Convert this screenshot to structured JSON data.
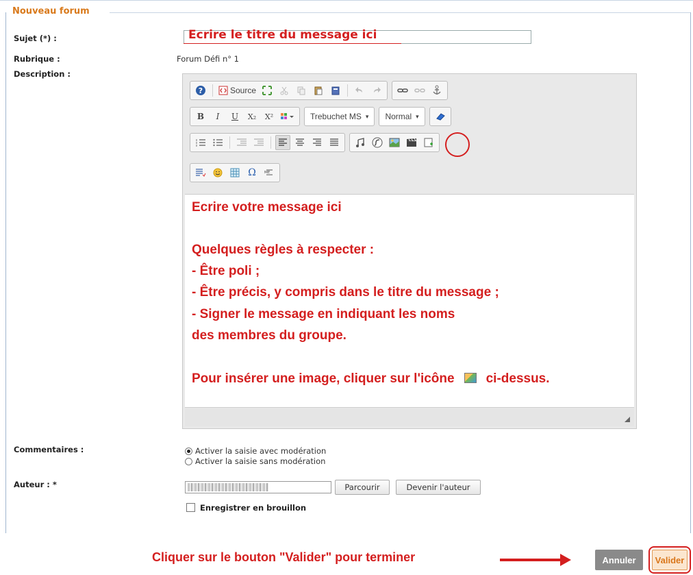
{
  "fieldset": {
    "legend": "Nouveau forum"
  },
  "labels": {
    "subject": "Sujet (*) :",
    "rubrique": "Rubrique :",
    "description": "Description :",
    "comments": "Commentaires :",
    "author": "Auteur : *"
  },
  "subject": {
    "value": "Ecrire le titre du message ici"
  },
  "rubrique": {
    "value": "Forum Défi n° 1"
  },
  "editor": {
    "toolbar": {
      "source_label": "Source",
      "bold": "B",
      "italic": "I",
      "underline": "U",
      "subscript": "X₂",
      "superscript": "X²",
      "font_label": "Trebuchet MS",
      "format_label": "Normal"
    },
    "body_lines": [
      "Ecrire votre message ici",
      "Quelques règles à respecter :",
      "- Être poli ;",
      "- Être précis, y compris dans le titre du message ;",
      "- Signer le message en indiquant les noms",
      "des membres du groupe."
    ],
    "image_hint_before": "Pour insérer une image, cliquer sur l'icône",
    "image_hint_after": "ci-dessus."
  },
  "comments": {
    "options": [
      {
        "label": "Activer la saisie avec modération",
        "selected": true
      },
      {
        "label": "Activer la saisie sans modération",
        "selected": false
      }
    ]
  },
  "author": {
    "browse_label": "Parcourir",
    "become_label": "Devenir l'auteur"
  },
  "draft": {
    "label": "Enregistrer en brouillon",
    "checked": false
  },
  "footer": {
    "instruction": "Cliquer sur le bouton \"Valider\" pour terminer",
    "cancel_label": "Annuler",
    "submit_label": "Valider"
  },
  "colors": {
    "accent": "#d97a1c",
    "annotation": "#d41f1f"
  }
}
